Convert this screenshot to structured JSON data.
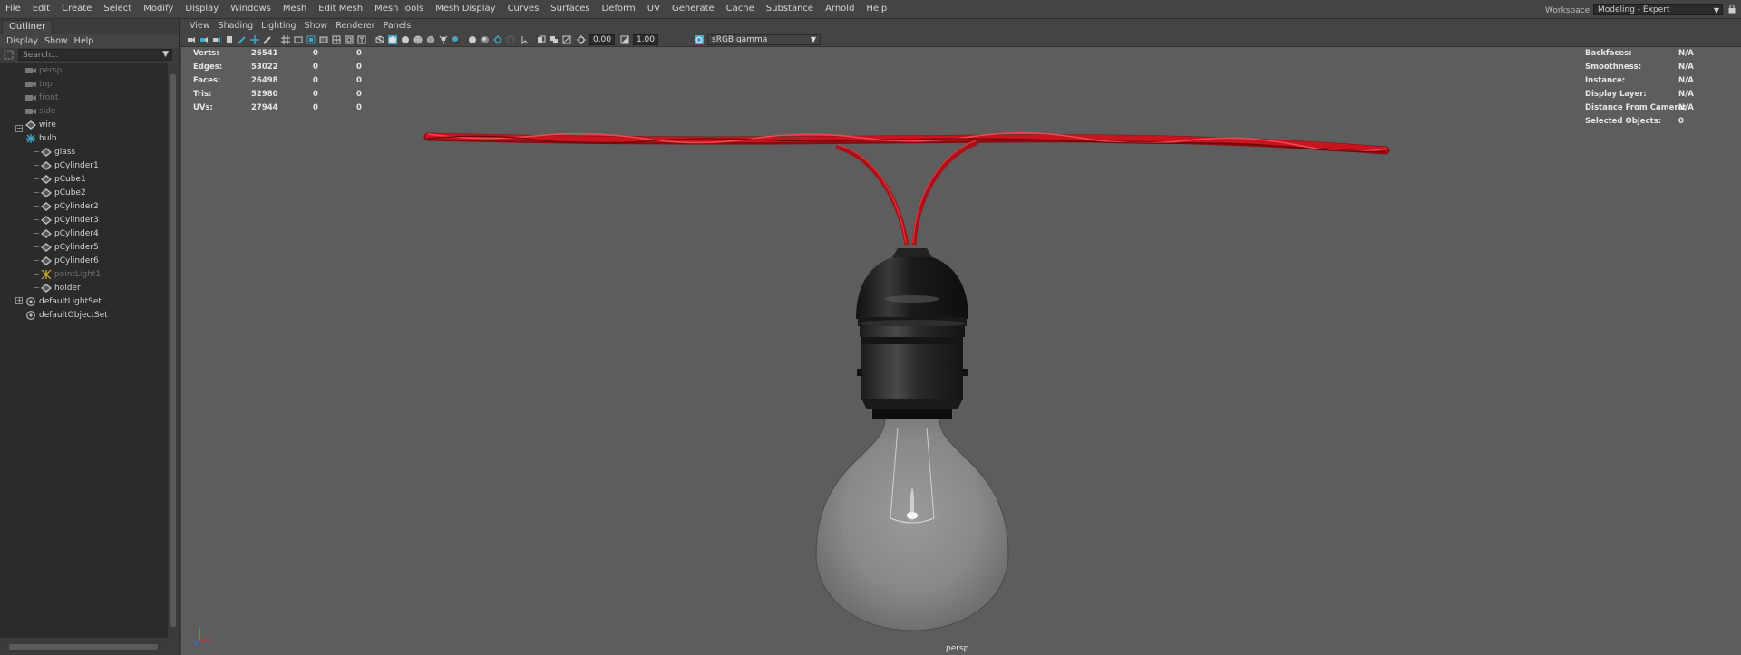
{
  "menubar": {
    "items": [
      "File",
      "Edit",
      "Create",
      "Select",
      "Modify",
      "Display",
      "Windows",
      "Mesh",
      "Edit Mesh",
      "Mesh Tools",
      "Mesh Display",
      "Curves",
      "Surfaces",
      "Deform",
      "UV",
      "Generate",
      "Cache",
      "Substance",
      "Arnold",
      "Help"
    ],
    "workspace_label": "Workspace :",
    "workspace_value": "Modeling - Expert"
  },
  "outliner": {
    "tab": "Outliner",
    "menu": [
      "Display",
      "Show",
      "Help"
    ],
    "search_placeholder": "Search...",
    "items": [
      {
        "label": "persp",
        "icon": "camera-icon",
        "dim": true
      },
      {
        "label": "top",
        "icon": "camera-icon",
        "dim": true
      },
      {
        "label": "front",
        "icon": "camera-icon",
        "dim": true
      },
      {
        "label": "side",
        "icon": "camera-icon",
        "dim": true
      },
      {
        "label": "wire",
        "icon": "mesh-icon",
        "dim": false
      },
      {
        "label": "bulb",
        "icon": "group-icon",
        "dim": false
      },
      {
        "label": "glass",
        "icon": "mesh-icon",
        "dim": false
      },
      {
        "label": "pCylinder1",
        "icon": "mesh-icon",
        "dim": false
      },
      {
        "label": "pCube1",
        "icon": "mesh-icon",
        "dim": false
      },
      {
        "label": "pCube2",
        "icon": "mesh-icon",
        "dim": false
      },
      {
        "label": "pCylinder2",
        "icon": "mesh-icon",
        "dim": false
      },
      {
        "label": "pCylinder3",
        "icon": "mesh-icon",
        "dim": false
      },
      {
        "label": "pCylinder4",
        "icon": "mesh-icon",
        "dim": false
      },
      {
        "label": "pCylinder5",
        "icon": "mesh-icon",
        "dim": false
      },
      {
        "label": "pCylinder6",
        "icon": "mesh-icon",
        "dim": false
      },
      {
        "label": "pointLight1",
        "icon": "point-light-icon",
        "dim": true
      },
      {
        "label": "holder",
        "icon": "mesh-icon",
        "dim": false
      },
      {
        "label": "defaultLightSet",
        "icon": "set-icon",
        "dim": false
      },
      {
        "label": "defaultObjectSet",
        "icon": "set-icon",
        "dim": false
      }
    ]
  },
  "panel": {
    "menu": [
      "View",
      "Shading",
      "Lighting",
      "Show",
      "Renderer",
      "Panels"
    ],
    "exposure": "0.00",
    "gamma": "1.00",
    "colorspace": "sRGB gamma"
  },
  "hud": {
    "stats": [
      {
        "label": "Verts:",
        "total": "26541",
        "selected": "0",
        "component": "0"
      },
      {
        "label": "Edges:",
        "total": "53022",
        "selected": "0",
        "component": "0"
      },
      {
        "label": "Faces:",
        "total": "26498",
        "selected": "0",
        "component": "0"
      },
      {
        "label": "Tris:",
        "total": "52980",
        "selected": "0",
        "component": "0"
      },
      {
        "label": "UVs:",
        "total": "27944",
        "selected": "0",
        "component": "0"
      }
    ],
    "info": [
      {
        "label": "Backfaces:",
        "value": "N/A"
      },
      {
        "label": "Smoothness:",
        "value": "N/A"
      },
      {
        "label": "Instance:",
        "value": "N/A"
      },
      {
        "label": "Display Layer:",
        "value": "N/A"
      },
      {
        "label": "Distance From Camera:",
        "value": "N/A"
      },
      {
        "label": "Selected Objects:",
        "value": "0"
      }
    ],
    "camera": "persp"
  },
  "colors": {
    "wire": "#c8141e",
    "viewport_bg": "#5d5d5d",
    "accent": "#3fa9c9"
  }
}
